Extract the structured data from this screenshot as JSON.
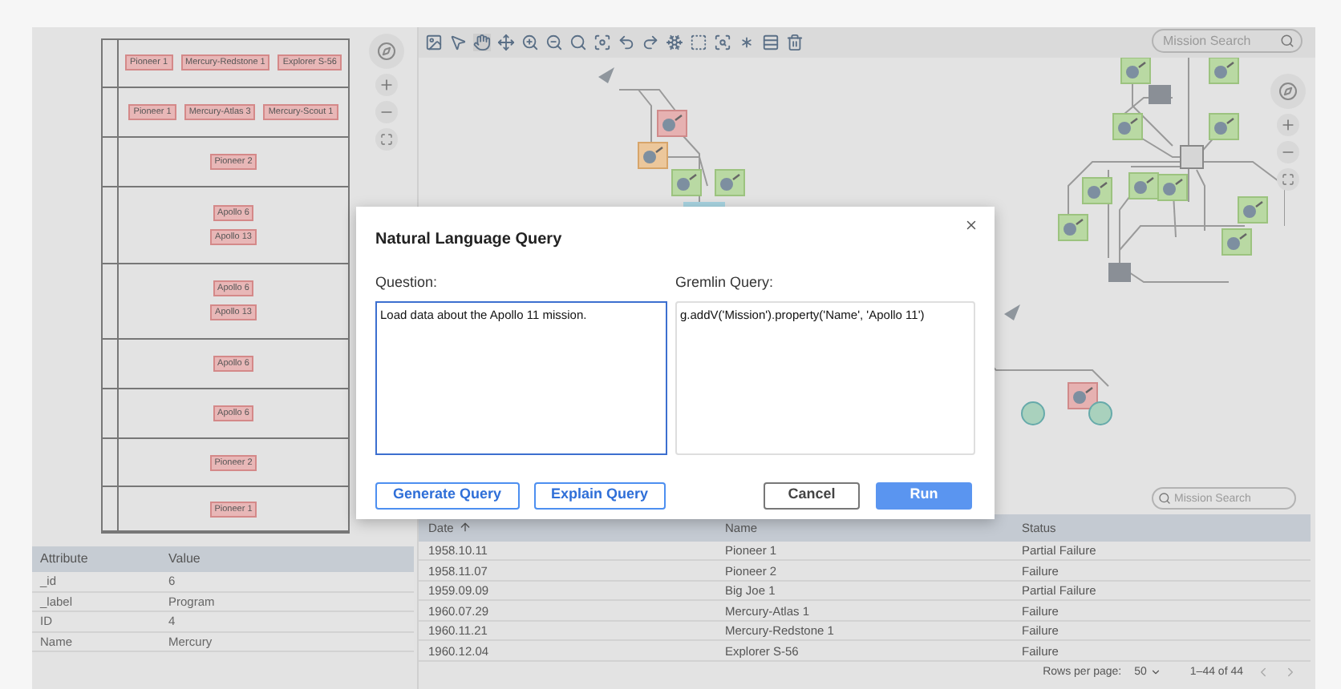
{
  "swimlanes": [
    {
      "tags": [
        "Pioneer 1",
        "Mercury-Redstone 1",
        "Explorer S-56"
      ]
    },
    {
      "tags": [
        "Pioneer 1",
        "Mercury-Atlas 3",
        "Mercury-Scout 1"
      ]
    },
    {
      "tags": [
        "Pioneer 2"
      ]
    },
    {
      "tags": [
        "Apollo 6",
        "Apollo 13"
      ]
    },
    {
      "tags": [
        "Apollo 6",
        "Apollo 13"
      ]
    },
    {
      "tags": [
        "Apollo 6"
      ]
    },
    {
      "tags": [
        "Apollo 6"
      ]
    },
    {
      "tags": [
        "Pioneer 2"
      ]
    },
    {
      "tags": [
        "Pioneer 1"
      ]
    }
  ],
  "attributes": {
    "columns": [
      "Attribute",
      "Value"
    ],
    "rows": [
      [
        "_id",
        "6"
      ],
      [
        "_label",
        "Program"
      ],
      [
        "ID",
        "4"
      ],
      [
        "Name",
        "Mercury"
      ]
    ]
  },
  "graph_search": {
    "placeholder": "Mission Search"
  },
  "dialog": {
    "title": "Natural Language Query",
    "question_label": "Question:",
    "question": "Load data about the Apollo 11 mission.",
    "gremlin_label": "Gremlin Query:",
    "gremlin": "g.addV('Mission').property('Name', 'Apollo 11')",
    "buttons": [
      {
        "label": "Generate Query",
        "kind": "outline"
      },
      {
        "label": "Explain Query",
        "kind": "outline"
      },
      {
        "label": "Cancel",
        "kind": "secondary"
      },
      {
        "label": "Run",
        "kind": "primary"
      }
    ]
  },
  "table_search": {
    "placeholder": "Mission Search"
  },
  "missions": {
    "columns": [
      {
        "label": "Date",
        "sorted": true
      },
      {
        "label": "Name",
        "sorted": false
      },
      {
        "label": "Status",
        "sorted": false
      }
    ],
    "rows": [
      [
        "1958.10.11",
        "Pioneer 1",
        "Partial Failure"
      ],
      [
        "1958.11.07",
        "Pioneer 2",
        "Failure"
      ],
      [
        "1959.09.09",
        "Big Joe 1",
        "Partial Failure"
      ],
      [
        "1960.07.29",
        "Mercury-Atlas 1",
        "Failure"
      ],
      [
        "1960.11.21",
        "Mercury-Redstone 1",
        "Failure"
      ],
      [
        "1960.12.04",
        "Explorer S-56",
        "Failure"
      ]
    ]
  },
  "pagination": {
    "rows_per_page_label": "Rows per page:",
    "rows_per_page": "50",
    "range": "1–44 of 44"
  }
}
